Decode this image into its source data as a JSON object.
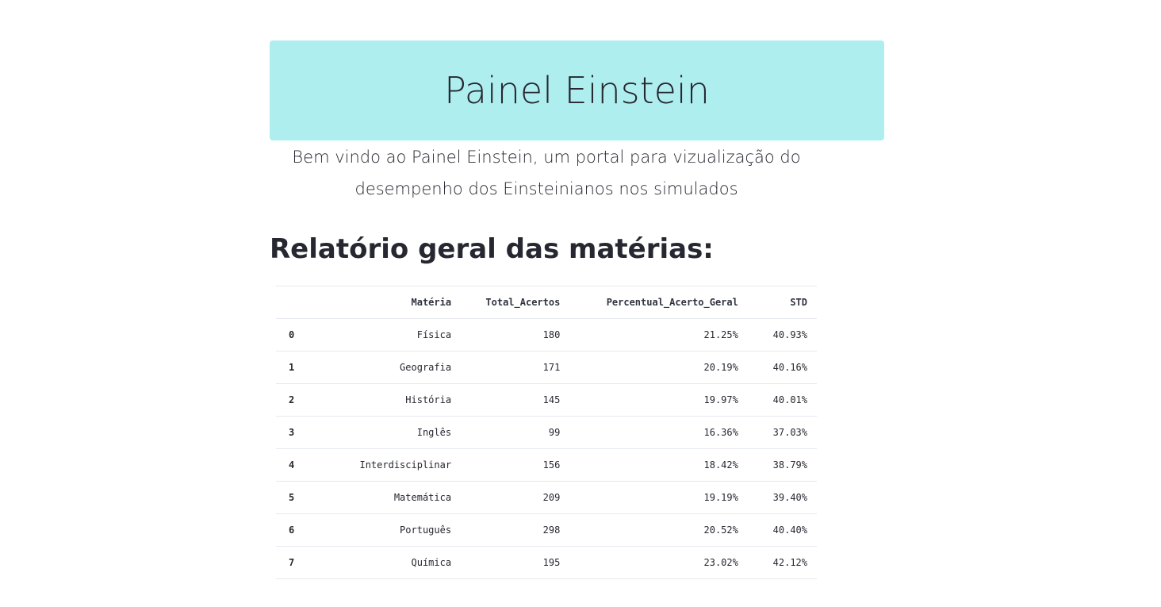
{
  "title": "Painel Einstein",
  "intro": "Bem vindo ao Painel Einstein, um portal para vizualização do desempenho dos Einsteinianos nos simulados",
  "section_title": "Relatório geral das matérias:",
  "banner_color": "#afeeee",
  "table": {
    "columns": [
      "",
      "Matéria",
      "Total_Acertos",
      "Percentual_Acerto_Geral",
      "STD"
    ],
    "rows": [
      [
        "0",
        "Física",
        "180",
        "21.25%",
        "40.93%"
      ],
      [
        "1",
        "Geografia",
        "171",
        "20.19%",
        "40.16%"
      ],
      [
        "2",
        "História",
        "145",
        "19.97%",
        "40.01%"
      ],
      [
        "3",
        "Inglês",
        "99",
        "16.36%",
        "37.03%"
      ],
      [
        "4",
        "Interdisciplinar",
        "156",
        "18.42%",
        "38.79%"
      ],
      [
        "5",
        "Matemática",
        "209",
        "19.19%",
        "39.40%"
      ],
      [
        "6",
        "Português",
        "298",
        "20.52%",
        "40.40%"
      ],
      [
        "7",
        "Química",
        "195",
        "23.02%",
        "42.12%"
      ]
    ]
  }
}
